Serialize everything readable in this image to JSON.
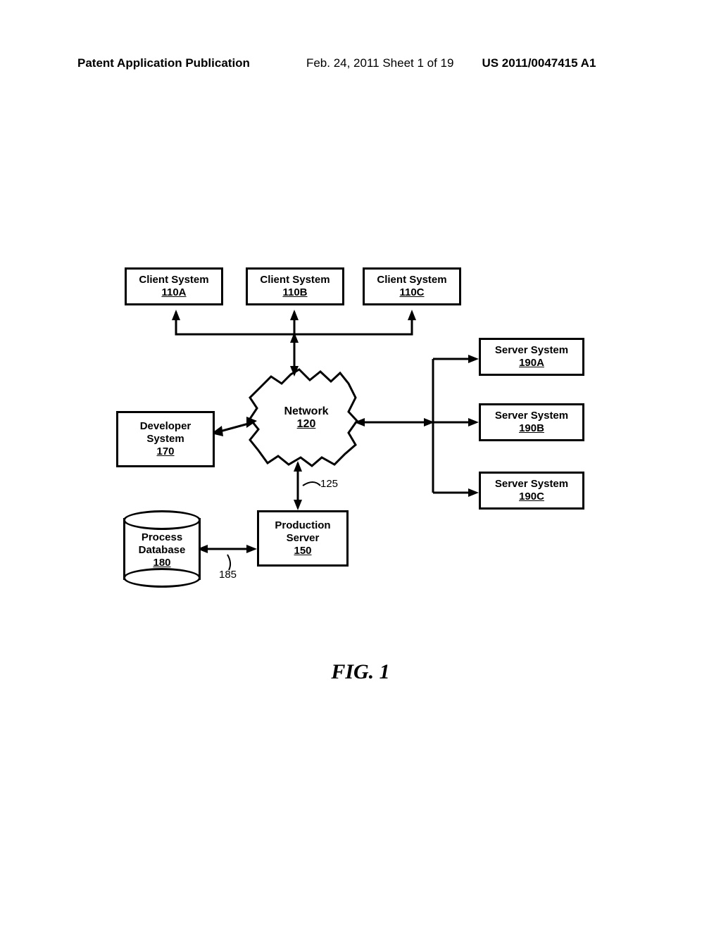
{
  "header": {
    "left": "Patent Application Publication",
    "mid": "Feb. 24, 2011  Sheet 1 of 19",
    "right": "US 2011/0047415 A1"
  },
  "boxes": {
    "client_a": {
      "title": "Client System",
      "ref": "110A"
    },
    "client_b": {
      "title": "Client System",
      "ref": "110B"
    },
    "client_c": {
      "title": "Client System",
      "ref": "110C"
    },
    "server_a": {
      "title": "Server System",
      "ref": "190A"
    },
    "server_b": {
      "title": "Server System",
      "ref": "190B"
    },
    "server_c": {
      "title": "Server System",
      "ref": "190C"
    },
    "developer": {
      "title": "Developer System",
      "ref": "170"
    },
    "production": {
      "title": "Production Server",
      "ref": "150"
    },
    "database": {
      "title": "Process Database",
      "ref": "180"
    },
    "network": {
      "title": "Network",
      "ref": "120"
    }
  },
  "annotations": {
    "link_net_prod": "125",
    "link_db_prod": "185"
  },
  "figure_caption": "FIG.  1"
}
